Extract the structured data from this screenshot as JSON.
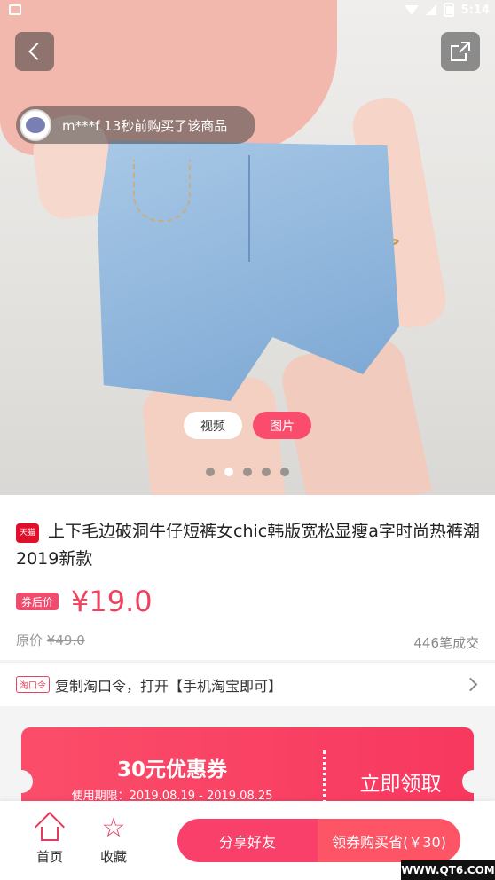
{
  "status_bar": {
    "time": "5:14"
  },
  "hero": {
    "recent_purchase": "m***f 13秒前购买了该商品",
    "media_tabs": [
      "视频",
      "图片"
    ],
    "active_tab": 1,
    "slide_count": 5,
    "active_slide": 1
  },
  "product": {
    "tmall_badge": "天猫",
    "title": "上下毛边破洞牛仔短裤女chic韩版宽松显瘦a字时尚热裤潮2019新款",
    "coupon_price_label": "券后价",
    "price": "¥19.0",
    "original_price_label": "原价",
    "original_price": "¥49.0",
    "sales": "446笔成交"
  },
  "taokouling": {
    "tag": "淘口令",
    "text": "复制淘口令，打开【手机淘宝即可】"
  },
  "coupon": {
    "amount": "30元优惠券",
    "period": "使用期限：2019.08.19 - 2019.08.25",
    "claim": "立即领取"
  },
  "bottom_bar": {
    "home": "首页",
    "favorite": "收藏",
    "share": "分享好友",
    "buy": "领券购买省(￥30)"
  },
  "watermark": "WWW.QT6.COM",
  "colors": {
    "accent": "#f9406a",
    "price": "#f0425f",
    "icon": "#e23b5d"
  }
}
